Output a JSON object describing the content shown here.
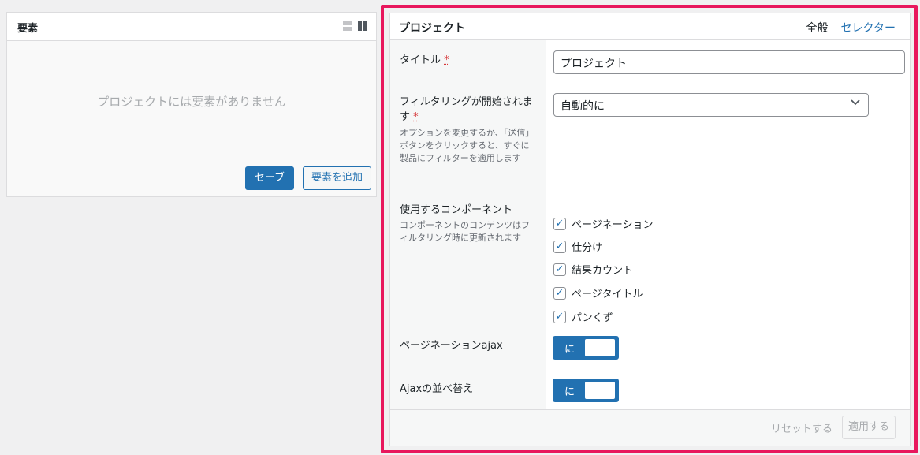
{
  "elements_panel": {
    "title": "要素",
    "empty_message": "プロジェクトには要素がありません",
    "save_label": "セーブ",
    "add_label": "要素を追加",
    "view_icons": [
      "list-view-icon",
      "grid-view-icon"
    ]
  },
  "project_panel": {
    "title": "プロジェクト",
    "tabs": [
      {
        "label": "全般",
        "active": true
      },
      {
        "label": "セレクター",
        "active": false
      }
    ],
    "fields": {
      "title": {
        "label": "タイトル",
        "required_mark": "*",
        "value": "プロジェクト"
      },
      "filtering": {
        "label": "フィルタリングが開始されます",
        "required_mark": "*",
        "description": "オプションを変更するか、「送信」ボタンをクリックすると、すぐに製品にフィルターを適用します",
        "selected": "自動的に"
      },
      "components": {
        "label": "使用するコンポーネント",
        "description": "コンポーネントのコンテンツはフィルタリング時に更新されます",
        "options": [
          {
            "label": "ページネーション",
            "checked": true
          },
          {
            "label": "仕分け",
            "checked": true
          },
          {
            "label": "結果カウント",
            "checked": true
          },
          {
            "label": "ページタイトル",
            "checked": true
          },
          {
            "label": "パンくず",
            "checked": true
          }
        ]
      },
      "pagination_ajax": {
        "label": "ページネーションajax",
        "toggle_text": "に",
        "on": true
      },
      "ajax_sort": {
        "label": "Ajaxの並べ替え",
        "toggle_text": "に",
        "on": true
      }
    },
    "footer": {
      "reset_label": "リセットする",
      "apply_label": "適用する"
    }
  },
  "colors": {
    "accent": "#2271b1",
    "highlight_frame": "#e8175d",
    "background": "#f0f0f1"
  }
}
